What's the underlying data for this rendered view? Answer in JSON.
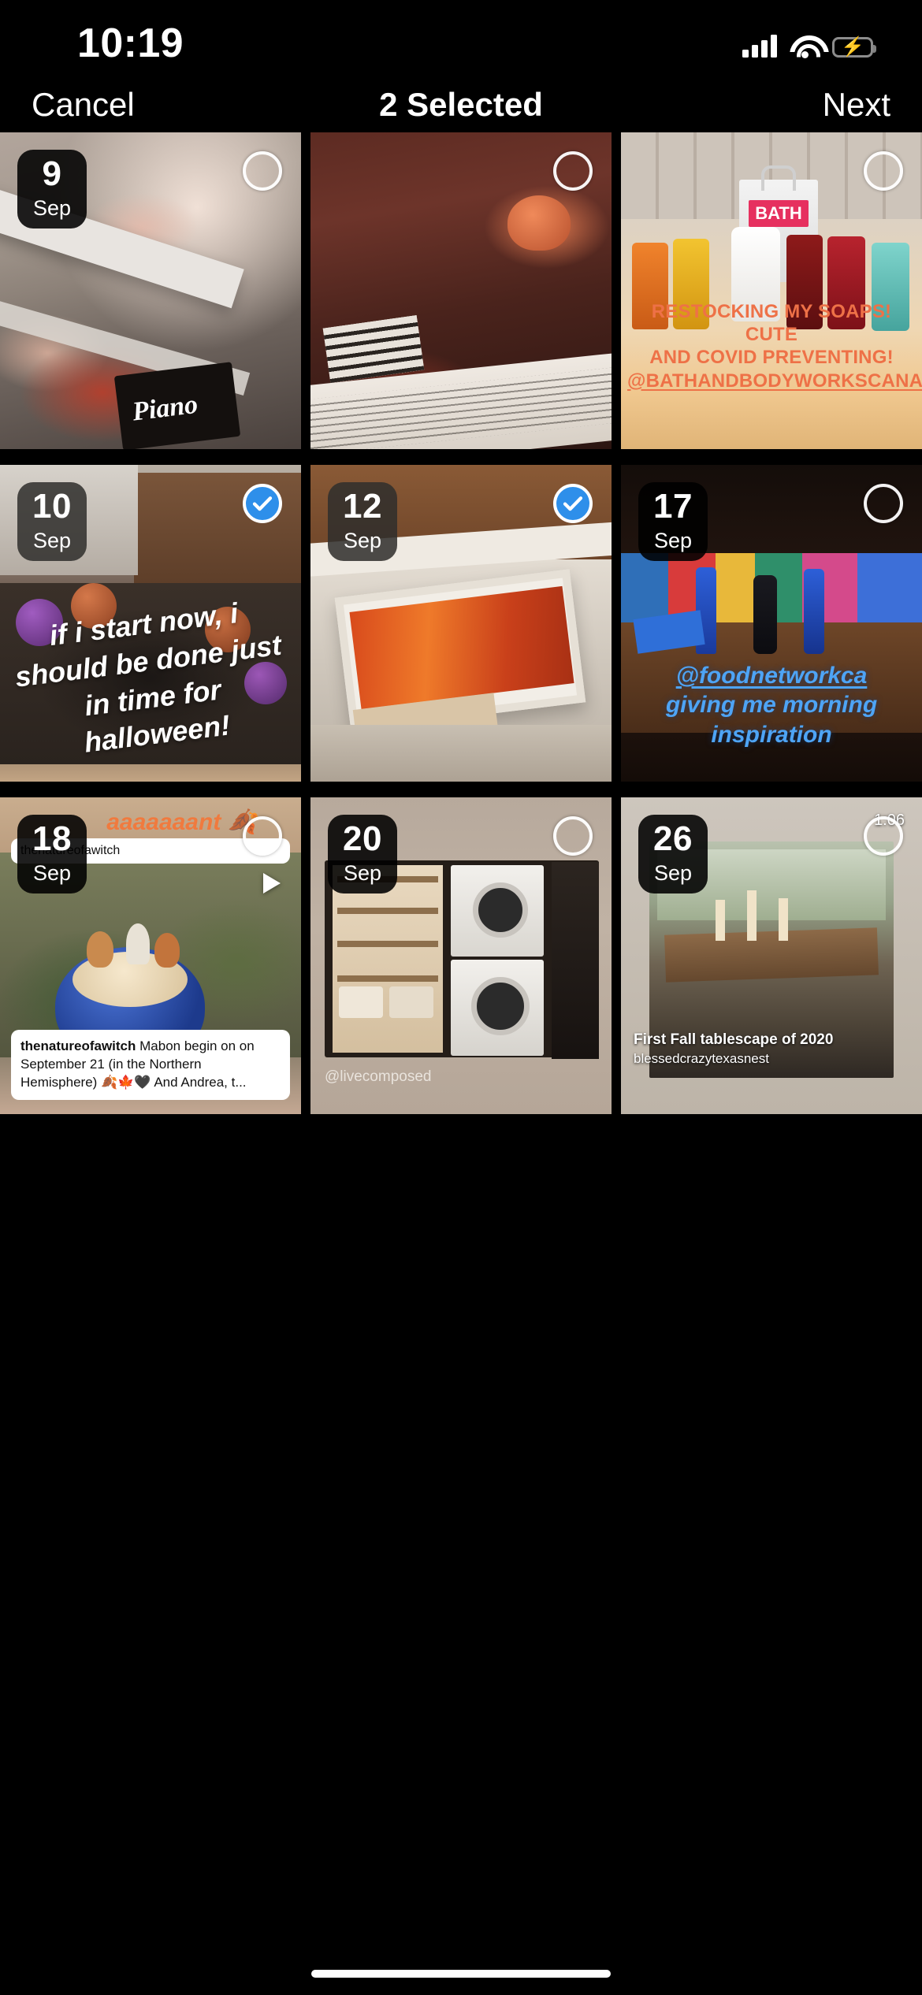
{
  "status_bar": {
    "time": "10:19",
    "cellular_icon": "signal-bars-icon",
    "wifi_icon": "wifi-icon",
    "battery_icon": "battery-charging-icon",
    "battery_color": "#30d158"
  },
  "nav_bar": {
    "cancel_label": "Cancel",
    "title": "2 Selected",
    "next_label": "Next"
  },
  "selection": {
    "count": 2,
    "accent_color": "#2e8fea",
    "checkmark_icon": "checkmark-icon",
    "unselected_icon": "empty-circle-icon"
  },
  "grid": {
    "columns": 3,
    "rows": 3,
    "month": "Sep",
    "items": [
      {
        "day": "9",
        "month": "Sep",
        "selected": false,
        "badge_style": "solid",
        "description": "Fall decor with knit pumpkins on a white side table and a Piano magazine",
        "overlays": []
      },
      {
        "day": "",
        "month": "",
        "selected": false,
        "badge_style": "none",
        "description": "Dim room with sheet music on a piano stand and autumn leaves",
        "overlays": []
      },
      {
        "day": "",
        "month": "",
        "selected": false,
        "badge_style": "none",
        "description": "Bath and Body Works soap bottles lined up on a counter with a BATH gift bag",
        "overlays": [
          {
            "type": "story-text",
            "color": "#ee7147",
            "lines": [
              "RESTOCKING MY SOAPS! CUTE",
              "AND COVID PREVENTING!"
            ],
            "link": "@BATHANDBODYWORKSCANADA"
          }
        ]
      },
      {
        "day": "10",
        "month": "Sep",
        "selected": true,
        "badge_style": "translucent",
        "description": "Tangled string of purple and orange halloween pumpkin lights",
        "overlays": [
          {
            "type": "story-text",
            "color": "#ffffff",
            "lines": [
              "if i start now, i",
              "should be done just",
              "in time for",
              "halloween!"
            ]
          }
        ]
      },
      {
        "day": "12",
        "month": "Sep",
        "selected": true,
        "badge_style": "translucent",
        "description": "Open drawer with red and orange fall garland inside a bathroom vanity",
        "overlays": []
      },
      {
        "day": "17",
        "month": "Sep",
        "selected": false,
        "badge_style": "solid",
        "description": "Blue glass bottles and colourful fabric on a table at a morning shoot",
        "overlays": [
          {
            "type": "story-text",
            "color": "#4ea4f5",
            "link": "@foodnetworkca",
            "lines": [
              "giving me morning",
              "inspiration"
            ]
          }
        ]
      },
      {
        "day": "18",
        "month": "Sep",
        "selected": false,
        "badge_style": "solid",
        "description": "Hand holding a blue glass bowl of latte topped with cinnamon pinecones",
        "overlays": [
          {
            "type": "story-text",
            "color": "#f07a3e",
            "lines": [
              "aaaaaaant 🍂"
            ]
          },
          {
            "type": "handle-pill",
            "text": "thenatureofawitch"
          },
          {
            "type": "play-button",
            "icon": "play-icon"
          },
          {
            "type": "caption",
            "author": "thenatureofawitch",
            "text": "Mabon begin on on September 21 (in the Northern Hemisphere) 🍂🍁🖤 And Andrea, t..."
          }
        ]
      },
      {
        "day": "20",
        "month": "Sep",
        "selected": false,
        "badge_style": "solid",
        "description": "Organised laundry room with stacked washer dryer and open shelving",
        "overlays": [
          {
            "type": "handle-text",
            "text": "@livecomposed"
          }
        ]
      },
      {
        "day": "26",
        "month": "Sep",
        "selected": false,
        "badge_style": "solid",
        "description": "Fall tablescape video with candles and pumpkins on a long dining table",
        "overlays": [
          {
            "type": "duration",
            "text": "1:06"
          },
          {
            "type": "video-caption",
            "title": "First Fall tablescape of 2020",
            "author": "blessedcrazytexasnest"
          }
        ]
      }
    ]
  },
  "home_indicator": {
    "label": "home-indicator"
  }
}
